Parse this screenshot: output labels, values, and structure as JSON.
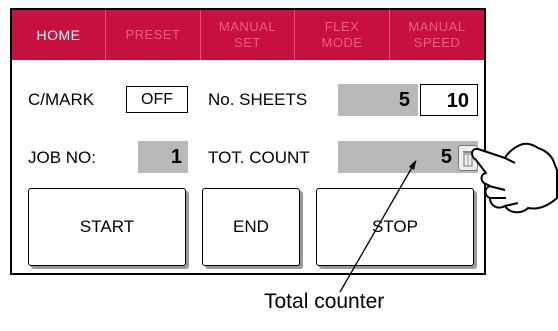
{
  "tabs": [
    {
      "label": "HOME",
      "active": true
    },
    {
      "label": "PRESET",
      "active": false
    },
    {
      "label": "MANUAL\nSET",
      "active": false
    },
    {
      "label": "FLEX\nMODE",
      "active": false
    },
    {
      "label": "MANUAL\nSPEED",
      "active": false
    }
  ],
  "cmark": {
    "label": "C/MARK",
    "value": "OFF"
  },
  "sheets": {
    "label": "No. SHEETS",
    "current": "5",
    "separator": "/",
    "total": "10"
  },
  "job": {
    "label": "JOB NO:",
    "value": "1"
  },
  "totcount": {
    "label": "TOT. COUNT",
    "value": "5"
  },
  "buttons": {
    "start": "START",
    "end": "END",
    "stop": "STOP"
  },
  "callout": {
    "text": "Total counter"
  },
  "icons": {
    "reset": "trash-icon",
    "hand": "pointing-hand-icon"
  },
  "colors": {
    "tab_bar": "#c8103e",
    "tab_inactive_text": "#e6607f",
    "value_box": "#b8b8b8"
  }
}
